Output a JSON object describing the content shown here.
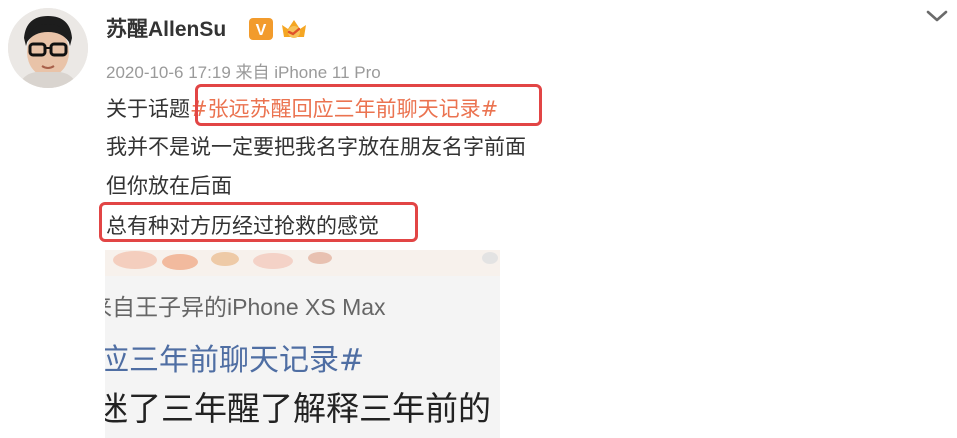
{
  "post": {
    "author": "苏醒AllenSu",
    "verified_badge": "V",
    "meta": "2020-10-6 17:19 来自 iPhone 11 Pro",
    "line1_prefix": "关于话题",
    "line1_topic": "#张远苏醒回应三年前聊天记录#",
    "line2": "我并不是说一定要把我名字放在朋友名字前面",
    "line3": "但你放在后面",
    "line4": "总有种对方历经过抢救的感觉"
  },
  "image": {
    "caption_source": "来自王子异的iPhone XS Max",
    "caption_topic": "应三年前聊天记录#",
    "caption_text": "迷了三年醒了解释三年前的"
  },
  "icons": {
    "verified": "verified-v-icon",
    "level": "fan-level-badge-icon",
    "expand": "chevron-down-icon"
  },
  "colors": {
    "topic_link": "#eb7350",
    "highlight_border": "#e24545",
    "verified_orange": "#f29b2c"
  }
}
